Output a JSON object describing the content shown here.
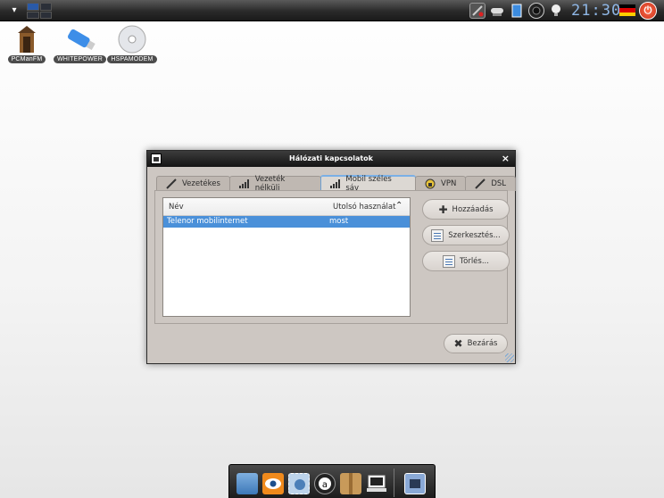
{
  "top_panel": {
    "clock": "21:30",
    "icons": [
      "menu-arrow-icon",
      "workspace-pager-icon",
      "network-disconnected-icon",
      "wired-network-icon",
      "documents-icon",
      "speaker-icon",
      "bulb-icon",
      "german-flag-icon",
      "power-icon"
    ]
  },
  "desktop": {
    "icons": [
      {
        "label": "PCManFM",
        "icon": "outhouse-icon"
      },
      {
        "label": "WHITEPOWER",
        "icon": "usb-drive-icon"
      },
      {
        "label": "HSPAMODEM",
        "icon": "cd-icon"
      }
    ]
  },
  "window": {
    "title": "Hálózati kapcsolatok",
    "close_glyph": "×",
    "tabs": [
      {
        "label": "Vezetékes",
        "icon": "wired-plug-icon"
      },
      {
        "label": "Vezeték nélküli",
        "icon": "signal-bars-icon"
      },
      {
        "label": "Mobil széles sáv",
        "icon": "signal-bars-icon",
        "active": true
      },
      {
        "label": "VPN",
        "icon": "vpn-lock-icon"
      },
      {
        "label": "DSL",
        "icon": "wired-plug-icon"
      }
    ],
    "list": {
      "columns": [
        "Név",
        "Utolsó használat"
      ],
      "rows": [
        {
          "name": "Telenor mobilinternet",
          "last_used": "most",
          "selected": true
        }
      ]
    },
    "buttons": {
      "add": "Hozzáadás",
      "edit": "Szerkesztés...",
      "delete": "Törlés...",
      "close": "Bezárás"
    }
  },
  "dock": {
    "items": [
      "folder-icon",
      "eye-icon",
      "mail-stamp-icon",
      "amarok-icon",
      "package-icon",
      "laptop-icon",
      "network-config-icon"
    ]
  },
  "colors": {
    "selection": "#4a90d9",
    "window_bg": "#cdc7c2",
    "panel": "#1a1a1a",
    "clock": "#8fb7e6"
  }
}
